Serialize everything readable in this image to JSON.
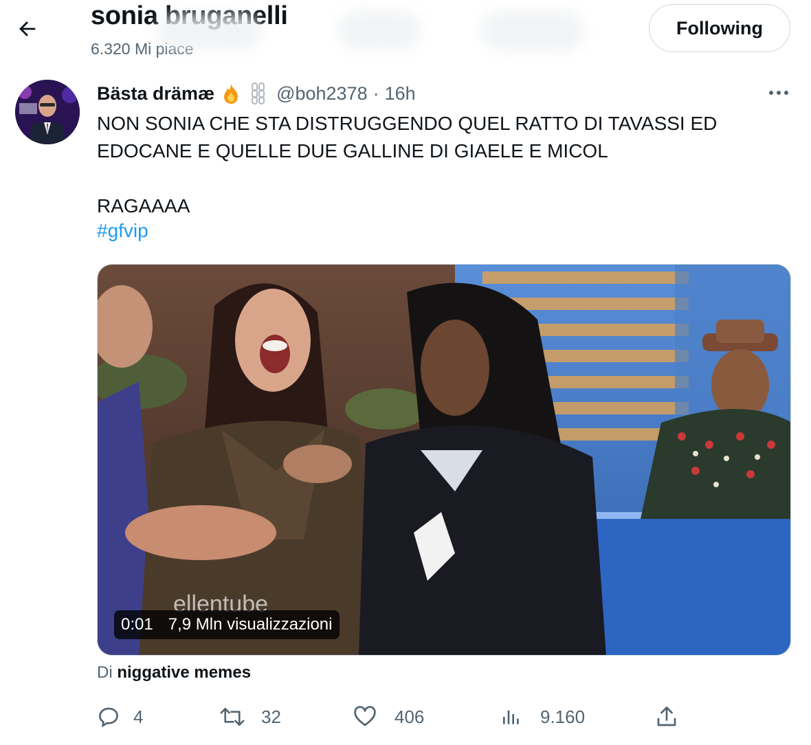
{
  "header": {
    "back_icon": "arrow-left-icon",
    "profile_name": "sonia bruganelli",
    "likes_count": "6.320 Mi piace",
    "follow_button_label": "Following"
  },
  "tweet": {
    "author_name": "Bästa drämæ",
    "author_badges": [
      "fire-icon",
      "chain-icon"
    ],
    "handle": "@boh2378",
    "separator": "·",
    "time": "16h",
    "text_lines": [
      "NON SONIA CHE STA DISTRUGGENDO QUEL RATTO DI TAVASSI ED",
      "EDOCANE E QUELLE DUE GALLINE DI GIAELE E MICOL",
      "",
      "RAGAAAA"
    ],
    "hashtag": "#gfvip",
    "video": {
      "time": "0:01",
      "views": "7,9 Mln visualizzazioni",
      "watermark": "ellentube"
    },
    "source_prefix": "Di",
    "source_name": "niggative memes",
    "actions": {
      "replies": "4",
      "retweets": "32",
      "likes": "406",
      "views": "9.160"
    }
  },
  "colors": {
    "text": "#0f1419",
    "secondary": "#536471",
    "link": "#1d9bf0",
    "border": "#cfd9de"
  }
}
